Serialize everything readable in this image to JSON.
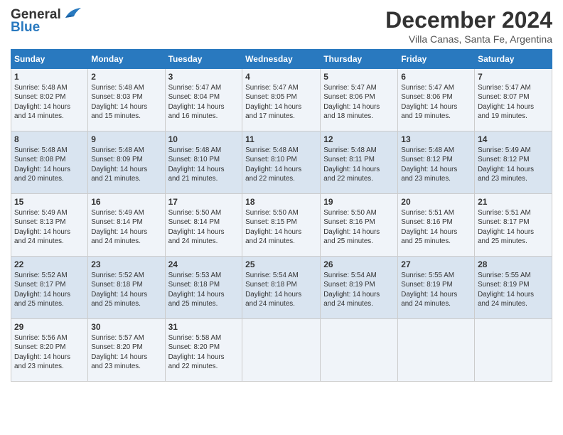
{
  "logo": {
    "line1": "General",
    "line2": "Blue"
  },
  "header": {
    "month": "December 2024",
    "location": "Villa Canas, Santa Fe, Argentina"
  },
  "days_of_week": [
    "Sunday",
    "Monday",
    "Tuesday",
    "Wednesday",
    "Thursday",
    "Friday",
    "Saturday"
  ],
  "weeks": [
    [
      {
        "day": 1,
        "info": "Sunrise: 5:48 AM\nSunset: 8:02 PM\nDaylight: 14 hours\nand 14 minutes."
      },
      {
        "day": 2,
        "info": "Sunrise: 5:48 AM\nSunset: 8:03 PM\nDaylight: 14 hours\nand 15 minutes."
      },
      {
        "day": 3,
        "info": "Sunrise: 5:47 AM\nSunset: 8:04 PM\nDaylight: 14 hours\nand 16 minutes."
      },
      {
        "day": 4,
        "info": "Sunrise: 5:47 AM\nSunset: 8:05 PM\nDaylight: 14 hours\nand 17 minutes."
      },
      {
        "day": 5,
        "info": "Sunrise: 5:47 AM\nSunset: 8:06 PM\nDaylight: 14 hours\nand 18 minutes."
      },
      {
        "day": 6,
        "info": "Sunrise: 5:47 AM\nSunset: 8:06 PM\nDaylight: 14 hours\nand 19 minutes."
      },
      {
        "day": 7,
        "info": "Sunrise: 5:47 AM\nSunset: 8:07 PM\nDaylight: 14 hours\nand 19 minutes."
      }
    ],
    [
      {
        "day": 8,
        "info": "Sunrise: 5:48 AM\nSunset: 8:08 PM\nDaylight: 14 hours\nand 20 minutes."
      },
      {
        "day": 9,
        "info": "Sunrise: 5:48 AM\nSunset: 8:09 PM\nDaylight: 14 hours\nand 21 minutes."
      },
      {
        "day": 10,
        "info": "Sunrise: 5:48 AM\nSunset: 8:10 PM\nDaylight: 14 hours\nand 21 minutes."
      },
      {
        "day": 11,
        "info": "Sunrise: 5:48 AM\nSunset: 8:10 PM\nDaylight: 14 hours\nand 22 minutes."
      },
      {
        "day": 12,
        "info": "Sunrise: 5:48 AM\nSunset: 8:11 PM\nDaylight: 14 hours\nand 22 minutes."
      },
      {
        "day": 13,
        "info": "Sunrise: 5:48 AM\nSunset: 8:12 PM\nDaylight: 14 hours\nand 23 minutes."
      },
      {
        "day": 14,
        "info": "Sunrise: 5:49 AM\nSunset: 8:12 PM\nDaylight: 14 hours\nand 23 minutes."
      }
    ],
    [
      {
        "day": 15,
        "info": "Sunrise: 5:49 AM\nSunset: 8:13 PM\nDaylight: 14 hours\nand 24 minutes."
      },
      {
        "day": 16,
        "info": "Sunrise: 5:49 AM\nSunset: 8:14 PM\nDaylight: 14 hours\nand 24 minutes."
      },
      {
        "day": 17,
        "info": "Sunrise: 5:50 AM\nSunset: 8:14 PM\nDaylight: 14 hours\nand 24 minutes."
      },
      {
        "day": 18,
        "info": "Sunrise: 5:50 AM\nSunset: 8:15 PM\nDaylight: 14 hours\nand 24 minutes."
      },
      {
        "day": 19,
        "info": "Sunrise: 5:50 AM\nSunset: 8:16 PM\nDaylight: 14 hours\nand 25 minutes."
      },
      {
        "day": 20,
        "info": "Sunrise: 5:51 AM\nSunset: 8:16 PM\nDaylight: 14 hours\nand 25 minutes."
      },
      {
        "day": 21,
        "info": "Sunrise: 5:51 AM\nSunset: 8:17 PM\nDaylight: 14 hours\nand 25 minutes."
      }
    ],
    [
      {
        "day": 22,
        "info": "Sunrise: 5:52 AM\nSunset: 8:17 PM\nDaylight: 14 hours\nand 25 minutes."
      },
      {
        "day": 23,
        "info": "Sunrise: 5:52 AM\nSunset: 8:18 PM\nDaylight: 14 hours\nand 25 minutes."
      },
      {
        "day": 24,
        "info": "Sunrise: 5:53 AM\nSunset: 8:18 PM\nDaylight: 14 hours\nand 25 minutes."
      },
      {
        "day": 25,
        "info": "Sunrise: 5:54 AM\nSunset: 8:18 PM\nDaylight: 14 hours\nand 24 minutes."
      },
      {
        "day": 26,
        "info": "Sunrise: 5:54 AM\nSunset: 8:19 PM\nDaylight: 14 hours\nand 24 minutes."
      },
      {
        "day": 27,
        "info": "Sunrise: 5:55 AM\nSunset: 8:19 PM\nDaylight: 14 hours\nand 24 minutes."
      },
      {
        "day": 28,
        "info": "Sunrise: 5:55 AM\nSunset: 8:19 PM\nDaylight: 14 hours\nand 24 minutes."
      }
    ],
    [
      {
        "day": 29,
        "info": "Sunrise: 5:56 AM\nSunset: 8:20 PM\nDaylight: 14 hours\nand 23 minutes."
      },
      {
        "day": 30,
        "info": "Sunrise: 5:57 AM\nSunset: 8:20 PM\nDaylight: 14 hours\nand 23 minutes."
      },
      {
        "day": 31,
        "info": "Sunrise: 5:58 AM\nSunset: 8:20 PM\nDaylight: 14 hours\nand 22 minutes."
      },
      {
        "day": null,
        "info": ""
      },
      {
        "day": null,
        "info": ""
      },
      {
        "day": null,
        "info": ""
      },
      {
        "day": null,
        "info": ""
      }
    ]
  ]
}
